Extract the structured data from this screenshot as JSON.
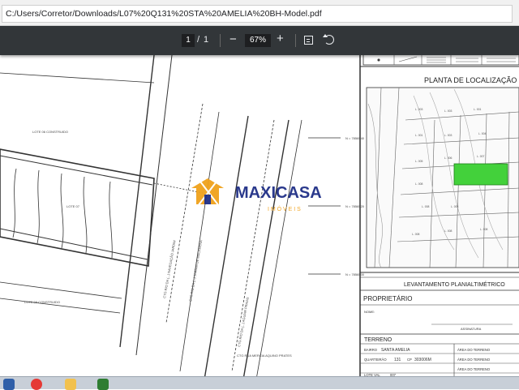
{
  "address_bar": {
    "url": "C:/Users/Corretor/Downloads/L07%20Q131%20STA%20AMELIA%20BH-Model.pdf"
  },
  "pdf_toolbar": {
    "page_current": "1",
    "page_separator": "/",
    "page_total": "1",
    "zoom_out_label": "−",
    "zoom_level": "67%",
    "zoom_in_label": "+"
  },
  "drawing": {
    "lote_top_label": "LOTE 06 CONSTRUIDO",
    "lote_bottom_label": "LOTE 08 CONSTRUIDO",
    "lote_center_label": "LOTE 07",
    "road_1": "CTG RIO DA (...) NAVEGAÇÃO JARDIM",
    "road_2": "CTG RIO DA (...) JARDIM DE MACARENA",
    "road_3": "CTG RIO DA (...) AGUIAR PRAIAS",
    "rua_label": "CTG RUA MERCIA AQUINO PRATES",
    "marker_1": "N = 7856540",
    "marker_2": "N = 7856520",
    "marker_3": "N = 7856500"
  },
  "watermark": {
    "brand": "MAXICASA",
    "subtitle": "I M Ó V E I S",
    "colors": {
      "orange": "#f0a21c",
      "blue": "#1f2f86"
    }
  },
  "title_block": {
    "location_title": "PLANTA DE LOCALIZAÇÃO",
    "survey_title": "LEVANTAMENTO PLANIALTIMÉTRICO",
    "owner_heading": "PROPRIETÁRIO",
    "name_label": "NOME:",
    "signature_label": "ASSINATURA",
    "land_heading": "TERRENO",
    "bairro_label": "BAIRRO",
    "bairro_value": "SANTA AMELIA",
    "quarteirao_label": "QUARTEIRÃO",
    "quarteirao_value": "131",
    "cp_label": "CP",
    "cp_value": "303006M",
    "area_label_1": "ÁREA DO TERRENO",
    "area_label_2": "ÁREA DO TERRENO",
    "area_label_3": "ÁREA DO TERRENO",
    "lote_label": "LOTE VAL",
    "lote_value": "007",
    "highlight_color": "#43d13b"
  }
}
